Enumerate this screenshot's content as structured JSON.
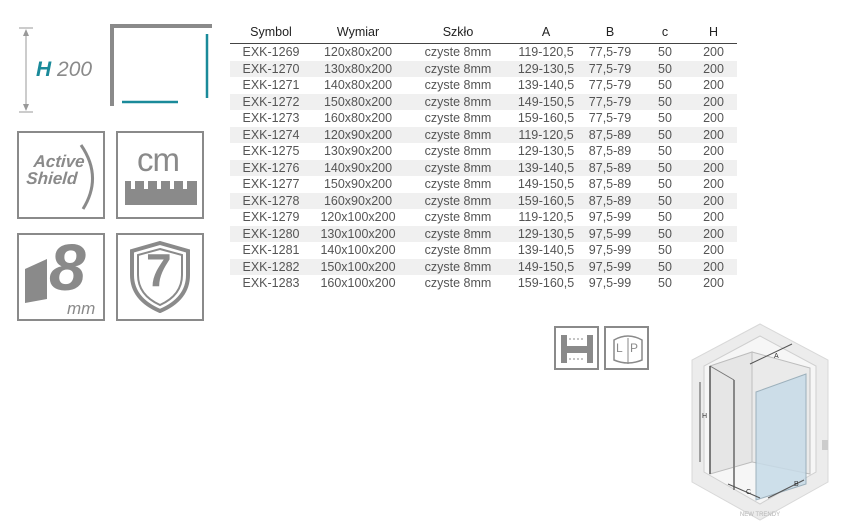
{
  "height_badge": {
    "letter": "H",
    "value": "200"
  },
  "badges": {
    "active_shield": {
      "line1": "Active",
      "line2": "Shield"
    },
    "cm_label": "cm",
    "thickness": {
      "number": "8",
      "unit": "mm"
    },
    "shield_number": "7"
  },
  "table": {
    "headers": [
      "Symbol",
      "Wymiar",
      "Szkło",
      "A",
      "B",
      "c",
      "H"
    ],
    "rows": [
      [
        "EXK-1269",
        "120x80x200",
        "czyste 8mm",
        "119-120,5",
        "77,5-79",
        "50",
        "200"
      ],
      [
        "EXK-1270",
        "130x80x200",
        "czyste 8mm",
        "129-130,5",
        "77,5-79",
        "50",
        "200"
      ],
      [
        "EXK-1271",
        "140x80x200",
        "czyste 8mm",
        "139-140,5",
        "77,5-79",
        "50",
        "200"
      ],
      [
        "EXK-1272",
        "150x80x200",
        "czyste 8mm",
        "149-150,5",
        "77,5-79",
        "50",
        "200"
      ],
      [
        "EXK-1273",
        "160x80x200",
        "czyste 8mm",
        "159-160,5",
        "77,5-79",
        "50",
        "200"
      ],
      [
        "EXK-1274",
        "120x90x200",
        "czyste 8mm",
        "119-120,5",
        "87,5-89",
        "50",
        "200"
      ],
      [
        "EXK-1275",
        "130x90x200",
        "czyste 8mm",
        "129-130,5",
        "87,5-89",
        "50",
        "200"
      ],
      [
        "EXK-1276",
        "140x90x200",
        "czyste 8mm",
        "139-140,5",
        "87,5-89",
        "50",
        "200"
      ],
      [
        "EXK-1277",
        "150x90x200",
        "czyste 8mm",
        "149-150,5",
        "87,5-89",
        "50",
        "200"
      ],
      [
        "EXK-1278",
        "160x90x200",
        "czyste 8mm",
        "159-160,5",
        "87,5-89",
        "50",
        "200"
      ],
      [
        "EXK-1279",
        "120x100x200",
        "czyste 8mm",
        "119-120,5",
        "97,5-99",
        "50",
        "200"
      ],
      [
        "EXK-1280",
        "130x100x200",
        "czyste 8mm",
        "129-130,5",
        "97,5-99",
        "50",
        "200"
      ],
      [
        "EXK-1281",
        "140x100x200",
        "czyste 8mm",
        "139-140,5",
        "97,5-99",
        "50",
        "200"
      ],
      [
        "EXK-1282",
        "150x100x200",
        "czyste 8mm",
        "149-150,5",
        "97,5-99",
        "50",
        "200"
      ],
      [
        "EXK-1283",
        "160x100x200",
        "czyste 8mm",
        "159-160,5",
        "97,5-99",
        "50",
        "200"
      ]
    ]
  },
  "lp_icon": {
    "left": "L",
    "right": "P"
  },
  "diagram_labels": {
    "a": "A",
    "b": "B",
    "c": "C",
    "h": "H"
  },
  "watermark": "NEW TRENDY",
  "colors": {
    "accent": "#1a8a9a",
    "icon_grey": "#8a8a8a",
    "text": "#555555"
  }
}
